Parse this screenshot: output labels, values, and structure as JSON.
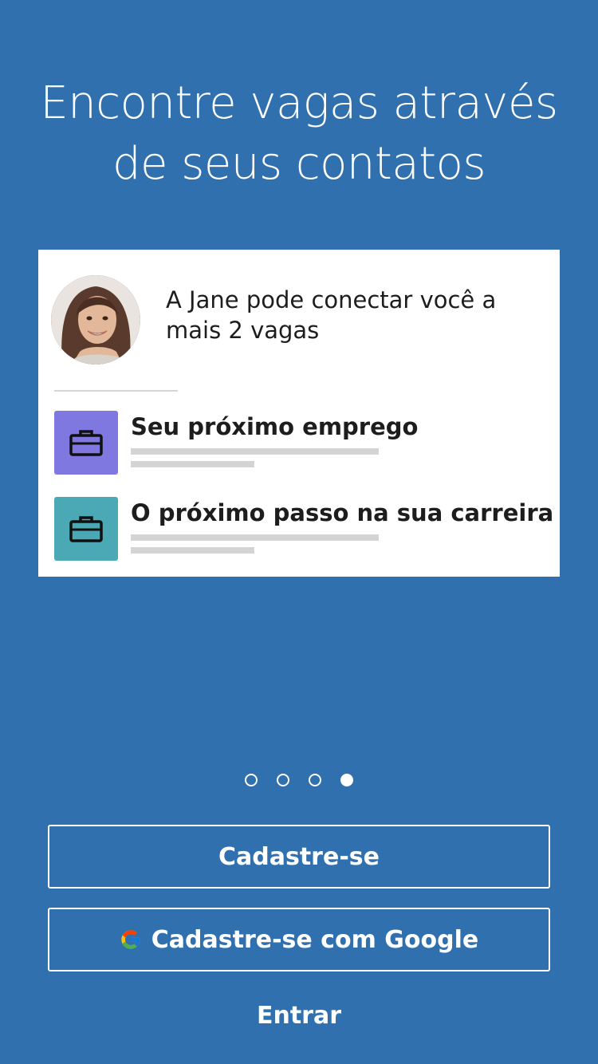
{
  "headline": {
    "line1": "Encontre vagas através",
    "line2": "de seus contatos"
  },
  "card": {
    "connection_text": "A Jane pode conectar você a mais 2 vagas",
    "jobs": [
      {
        "title": "Seu próximo emprego",
        "icon": "briefcase-icon",
        "color": "#7f78e0"
      },
      {
        "title": "O próximo passo na sua carreira",
        "icon": "briefcase-icon",
        "color": "#4aa9b4"
      }
    ]
  },
  "pager": {
    "total": 4,
    "active_index": 3
  },
  "buttons": {
    "signup_label": "Cadastre-se",
    "google_signup_label": "Cadastre-se com Google",
    "signin_label": "Entrar"
  },
  "colors": {
    "background": "#3070ae",
    "card": "#ffffff",
    "text_dark": "#1d1d1d"
  }
}
